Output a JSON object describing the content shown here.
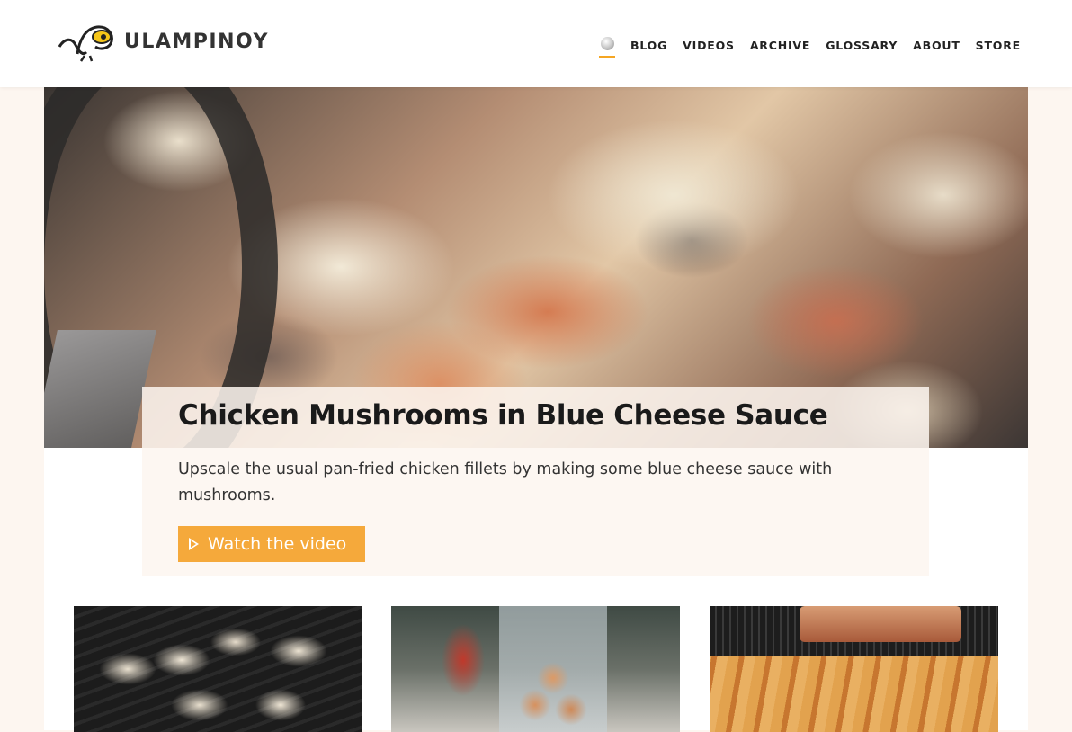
{
  "header": {
    "logo_text": "ULAMPINOY",
    "nav": {
      "home_icon": "home-orb-icon",
      "items": [
        {
          "label": "BLOG"
        },
        {
          "label": "VIDEOS"
        },
        {
          "label": "ARCHIVE"
        },
        {
          "label": "GLOSSARY"
        },
        {
          "label": "ABOUT"
        },
        {
          "label": "STORE"
        }
      ]
    }
  },
  "hero": {
    "title": "Chicken Mushrooms in Blue Cheese Sauce",
    "description": "Upscale the usual pan-fried chicken fillets by making some blue cheese sauce with mushrooms.",
    "cta_label": "Watch the video",
    "cta_icon": "play-icon"
  },
  "thumbnails": [
    {
      "subject": "grilled mushrooms"
    },
    {
      "subject": "jar of salted eggs"
    },
    {
      "subject": "lumpia spring rolls"
    }
  ],
  "colors": {
    "accent": "#f5a93b",
    "nav_underline": "#f5a623",
    "page_bg": "#fdf6f0",
    "header_bg": "#ffffff"
  }
}
